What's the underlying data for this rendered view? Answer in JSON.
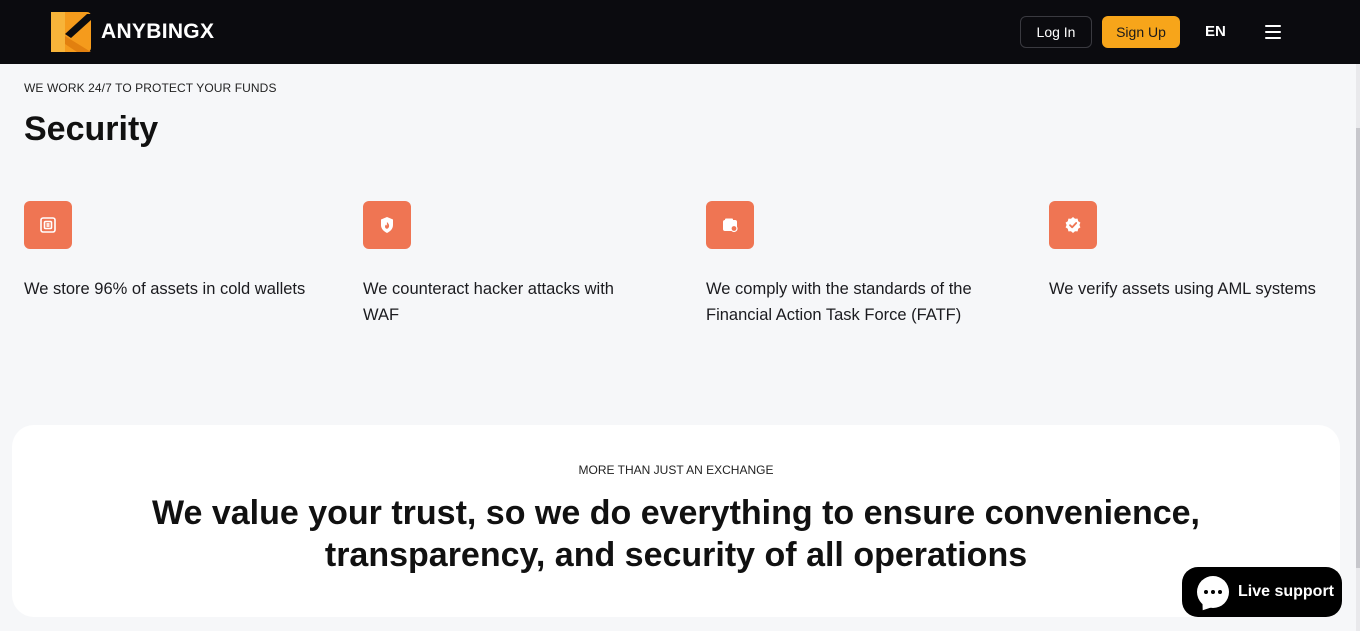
{
  "header": {
    "brand": "ANYBINGX",
    "login_label": "Log In",
    "signup_label": "Sign Up",
    "language": "EN",
    "colors": {
      "bar": "#0b0b0f",
      "accent": "#f7a51a"
    }
  },
  "security": {
    "eyebrow": "WE WORK 24/7 TO PROTECT YOUR FUNDS",
    "title": "Security",
    "features": [
      {
        "icon": "cold-wallet-icon",
        "text": "We store 96% of assets in cold wallets"
      },
      {
        "icon": "shield-fire-icon",
        "text": "We counteract hacker attacks with WAF"
      },
      {
        "icon": "wallet-badge-icon",
        "text": "We comply with the standards of the Financial Action Task Force (FATF)"
      },
      {
        "icon": "verified-badge-icon",
        "text": "We verify assets using AML systems"
      }
    ],
    "icon_color": "#ef7553"
  },
  "trust": {
    "eyebrow": "MORE THAN JUST AN EXCHANGE",
    "headline": "We value your trust, so we do everything to ensure convenience, transparency, and security of all operations"
  },
  "support": {
    "label": "Live support"
  }
}
